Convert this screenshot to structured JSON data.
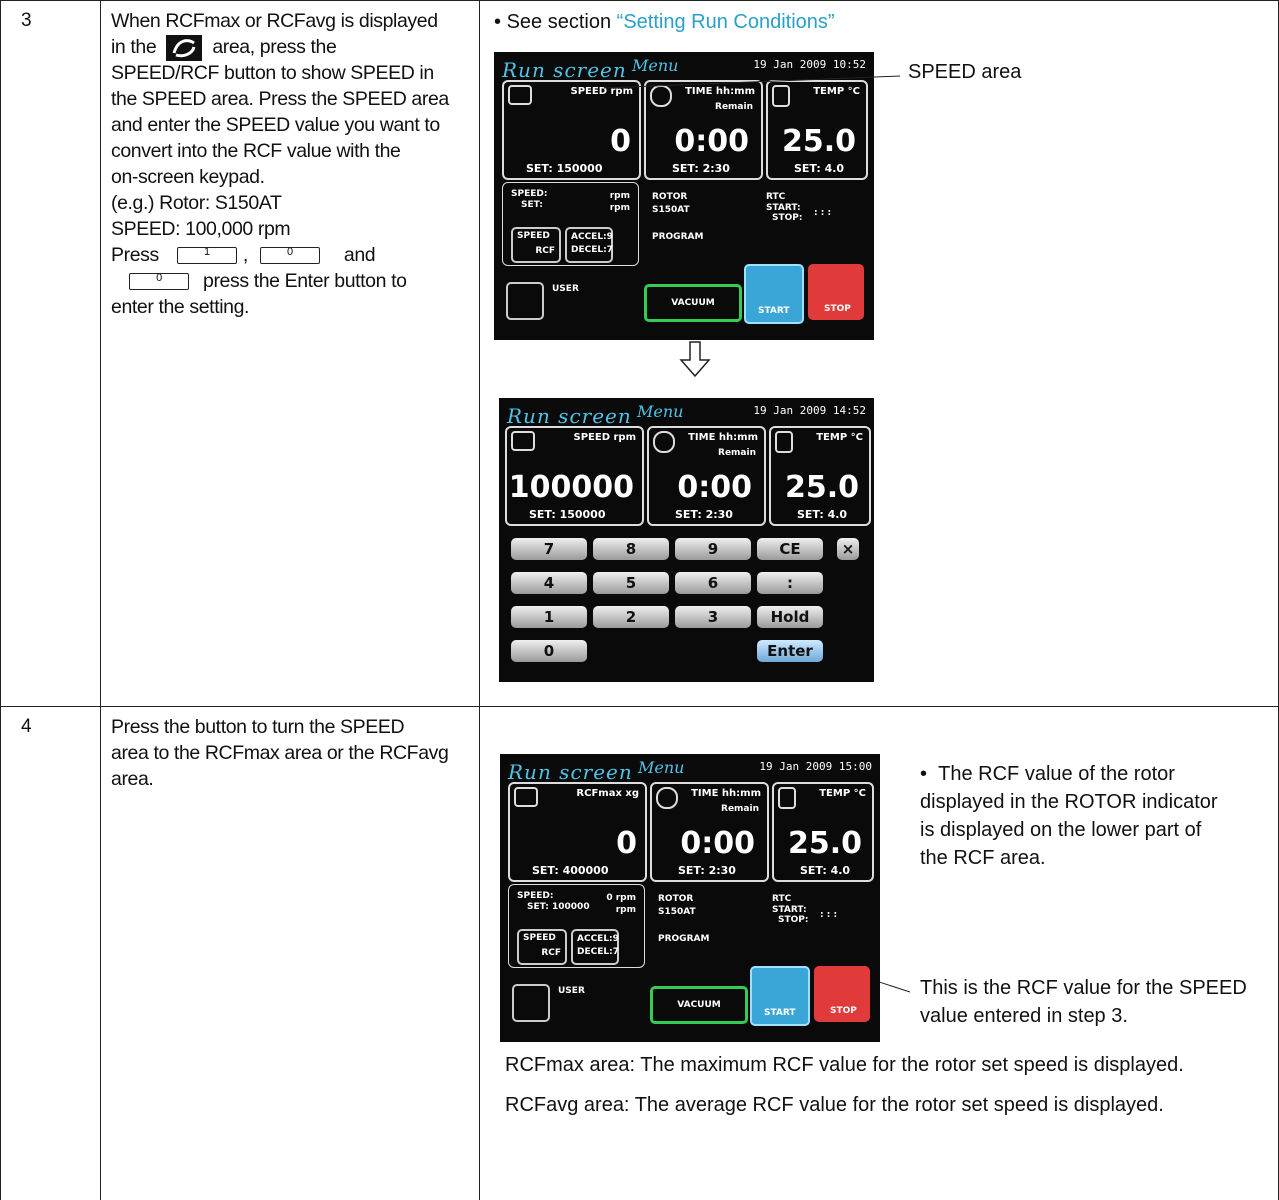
{
  "rows": [
    {
      "step": "3",
      "desc": {
        "l1": "When RCFmax or RCFavg is displayed",
        "l2a": "in the",
        "l2b": "area, press the",
        "l3": "SPEED/RCF button to show SPEED in",
        "l4": "the SPEED area. Press the SPEED area",
        "l5": "and enter the SPEED value you want to",
        "l6": "convert into the RCF value with the",
        "l7": "on-screen keypad.",
        "l8": "(e.g.) Rotor: S150AT",
        "l9": "SPEED: 100,000 rpm",
        "l10a": "Press",
        "l10sep": ",",
        "l10b": "and",
        "l11": "press the Enter button to",
        "l12": "enter the setting.",
        "key1": "1",
        "key2": "0",
        "key3": "0"
      },
      "bullet": "•",
      "see": "See section",
      "link": "“Setting Run Conditions”",
      "callout_speed": "SPEED area"
    },
    {
      "step": "4",
      "desc": {
        "l1": "Press the button to turn the SPEED",
        "l2": "area to the RCFmax area or the RCFavg",
        "l3": "area."
      },
      "note1": {
        "bullet": "•",
        "l1": "The RCF value of the rotor",
        "l2": "displayed in the ROTOR indicator",
        "l3": "is displayed on the lower part of",
        "l4": "the RCF area."
      },
      "note2": {
        "l1": "This is the RCF value for the SPEED",
        "l2": "value entered in step 3."
      },
      "rcfmax_text": "RCFmax area: The maximum RCF value for the rotor set speed is displayed.",
      "rcfavg_text": "RCFavg area: The average RCF value for the rotor set speed is displayed."
    }
  ],
  "screens": {
    "title": "Run screen",
    "menu": "Menu",
    "s1": {
      "date": "19 Jan 2009 10:52",
      "speed_label": "SPEED   rpm",
      "speed_value": "0",
      "speed_set": "SET:  150000",
      "time_label": "TIME   hh:mm",
      "remain": "Remain",
      "time_value": "0:00",
      "time_set": "SET:  2:30",
      "temp_label": "TEMP   °C",
      "temp_value": "25.0",
      "temp_set": "SET:  4.0",
      "info_speed": "SPEED:",
      "info_speed_unit": "rpm",
      "info_set": "SET:",
      "info_set_unit": "rpm",
      "rotor_label": "ROTOR",
      "rotor_value": "S150AT",
      "rtc_label": "RTC",
      "rtc_start": "START:",
      "rtc_stop": "STOP:",
      "rtc_dots": ":   :   :",
      "btn_speed": "SPEED",
      "btn_rcf": "RCF",
      "accel": "ACCEL:9",
      "decel": "DECEL:7",
      "program": "PROGRAM",
      "user": "USER",
      "vacuum": "VACUUM",
      "start": "START",
      "stop": "STOP"
    },
    "s2": {
      "date": "19 Jan 2009 14:52",
      "speed_label": "SPEED   rpm",
      "speed_value": "100000",
      "speed_set": "SET:  150000",
      "time_label": "TIME   hh:mm",
      "remain": "Remain",
      "time_value": "0:00",
      "time_set": "SET:  2:30",
      "temp_label": "TEMP   °C",
      "temp_value": "25.0",
      "temp_set": "SET:  4.0",
      "keys": [
        "7",
        "8",
        "9",
        "CE",
        "4",
        "5",
        "6",
        ":",
        "1",
        "2",
        "3",
        "Hold",
        "0",
        "Enter"
      ],
      "close": "×"
    },
    "s3": {
      "date": "19 Jan 2009 15:00",
      "speed_label": "RCFmax   xg",
      "speed_value": "0",
      "speed_set": "SET:  400000",
      "time_label": "TIME   hh:mm",
      "remain": "Remain",
      "time_value": "0:00",
      "time_set": "SET:  2:30",
      "temp_label": "TEMP   °C",
      "temp_value": "25.0",
      "temp_set": "SET:  4.0",
      "info_speed": "SPEED:",
      "info_speed_unit": "0 rpm",
      "info_set": "SET: 100000",
      "info_set_unit": "rpm",
      "rotor_label": "ROTOR",
      "rotor_value": "S150AT",
      "rtc_label": "RTC",
      "rtc_start": "START:",
      "rtc_stop": "STOP:",
      "rtc_dots": ":   :   :",
      "btn_speed": "SPEED",
      "btn_rcf": "RCF",
      "accel": "ACCEL:9",
      "decel": "DECEL:7",
      "program": "PROGRAM",
      "user": "USER",
      "vacuum": "VACUUM",
      "start": "START",
      "stop": "STOP"
    }
  },
  "colors": {
    "accent": "#2aa0c8",
    "screen_bg": "#0a0a0a",
    "start_btn": "#3aa6d8",
    "stop_btn": "#e03a3a",
    "vacuum": "#33cc55"
  }
}
